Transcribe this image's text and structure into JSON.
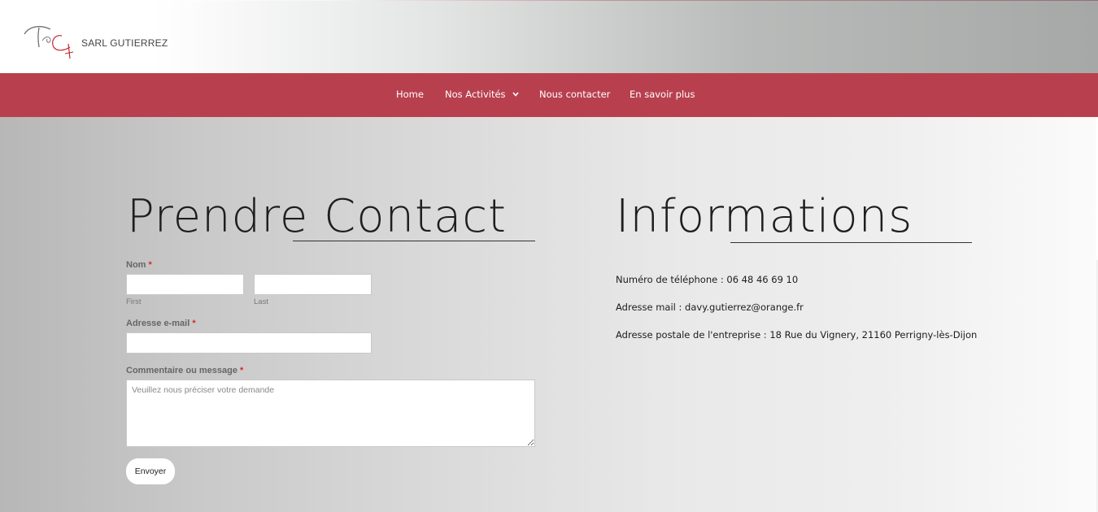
{
  "header": {
    "brand": "SARL GUTIERREZ"
  },
  "nav": {
    "items": [
      {
        "label": "Home"
      },
      {
        "label": "Nos Activités",
        "has_dropdown": true
      },
      {
        "label": "Nous contacter"
      },
      {
        "label": "En savoir plus"
      }
    ]
  },
  "contact": {
    "title_part1": "Prendre",
    "title_part2": "Contact",
    "name_label": "Nom",
    "required_mark": "*",
    "first_sublabel": "First",
    "last_sublabel": "Last",
    "first_value": "",
    "last_value": "",
    "email_label": "Adresse e-mail",
    "email_value": "",
    "message_label": "Commentaire ou message",
    "message_placeholder": "Veuillez nous préciser votre demande",
    "submit_label": "Envoyer"
  },
  "informations": {
    "title": "Informations",
    "phone": "Numéro de téléphone : 06 48 46 69 10",
    "email": "Adresse mail :  davy.gutierrez@orange.fr",
    "address": "Adresse postale de l'entreprise : 18 Rue du Vignery, 21160 Perrigny-lès-Dijon"
  },
  "colors": {
    "nav_background": "#b8404e",
    "required": "#d12c2c",
    "logo_accent": "#c0282f"
  },
  "icons": {
    "logo": "dg-monogram-logo",
    "dropdown": "chevron-down-icon",
    "resize": "resize-handle-icon"
  }
}
